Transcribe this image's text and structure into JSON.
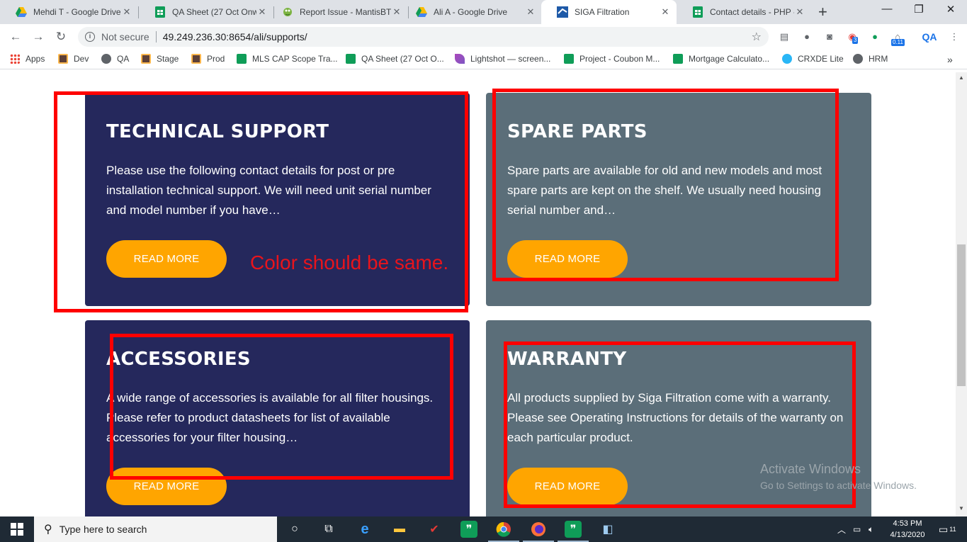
{
  "tabs": [
    {
      "title": "Mehdi T - Google Drive",
      "icon": "google-drive-icon"
    },
    {
      "title": "QA Sheet (27 Oct Onwa",
      "icon": "google-sheets-icon"
    },
    {
      "title": "Report Issue - MantisBT",
      "icon": "mantis-bug-icon"
    },
    {
      "title": "Ali A - Google Drive",
      "icon": "google-drive-icon"
    },
    {
      "title": "SIGA Filtration",
      "icon": "siga-favicon"
    },
    {
      "title": "Contact details - PHP -",
      "icon": "google-sheets-icon"
    }
  ],
  "omnibox": {
    "security_label": "Not secure",
    "url": "49.249.236.30:8654/ali/supports/"
  },
  "bookmarks": [
    {
      "label": "Apps",
      "icon": "apps-grid-icon"
    },
    {
      "label": "Dev",
      "icon": "bookmark-site-icon"
    },
    {
      "label": "QA",
      "icon": "globe-icon"
    },
    {
      "label": "Stage",
      "icon": "bookmark-site-icon"
    },
    {
      "label": "Prod",
      "icon": "bookmark-site-icon"
    },
    {
      "label": "MLS CAP Scope Tra...",
      "icon": "google-sheets-icon"
    },
    {
      "label": "QA Sheet (27 Oct O...",
      "icon": "google-sheets-icon"
    },
    {
      "label": "Lightshot — screen...",
      "icon": "lightshot-feather-icon"
    },
    {
      "label": "Project - Coubon M...",
      "icon": "google-sheets-icon"
    },
    {
      "label": "Mortgage Calculato...",
      "icon": "google-sheets-icon"
    },
    {
      "label": "CRXDE Lite",
      "icon": "crxde-icon"
    },
    {
      "label": "HRM",
      "icon": "globe-icon"
    }
  ],
  "extensions": {
    "badge_count": "3",
    "timer_badge": "0.11",
    "qa_label": "QA"
  },
  "cards": {
    "technical": {
      "title": "TECHNICAL SUPPORT",
      "body": "Please use the following contact details for post or pre installation technical support.  We will need unit serial number and model number if you have…",
      "button": "READ MORE"
    },
    "spare": {
      "title": "SPARE PARTS",
      "body": "Spare parts are available for old and new models and most spare parts are kept on the shelf. We usually need housing serial number and…",
      "button": "READ MORE"
    },
    "accessories": {
      "title": "ACCESSORIES",
      "body": "A wide range of accessories is available for all filter housings. Please refer to product datasheets for list of available accessories for your filter housing…",
      "button": "READ MORE"
    },
    "warranty": {
      "title": "WARRANTY",
      "body": "All products supplied by Siga Filtration come with a warranty. Please see Operating Instructions for details of the warranty on each particular product.",
      "button": "READ MORE"
    }
  },
  "annotation": {
    "note": "Color should be same.",
    "color": "#ff0000"
  },
  "watermark": {
    "title": "Activate Windows",
    "subtitle": "Go to Settings to activate Windows."
  },
  "taskbar": {
    "search_placeholder": "Type here to search",
    "time": "4:53 PM",
    "date": "4/13/2020",
    "notification_count": "11"
  },
  "colors": {
    "navy_card": "#25285c",
    "slate_card": "#5b6e79",
    "button_orange": "#ffa500"
  }
}
